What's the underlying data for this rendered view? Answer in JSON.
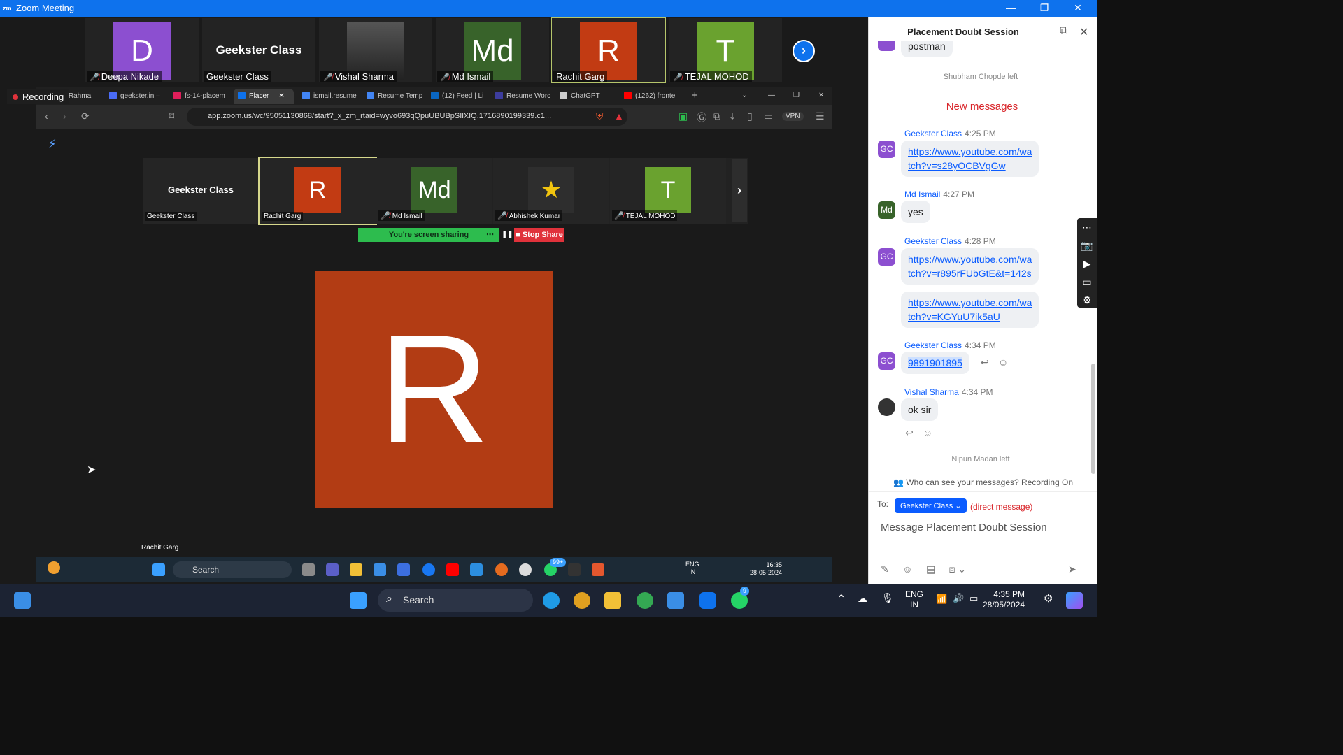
{
  "window": {
    "title": "Zoom Meeting",
    "app_icon": "zm"
  },
  "gallery": [
    {
      "initial": "D",
      "name": "Deepa Nikade",
      "color": "#8c4fd0",
      "muted": true
    },
    {
      "initial": "",
      "name": "Geekster Class",
      "label": "Geekster Class",
      "muted": false
    },
    {
      "initial": "",
      "name": "Vishal Sharma",
      "color": "#4a4a4a",
      "muted": true
    },
    {
      "initial": "Md",
      "name": "Md Ismail",
      "color": "#38632a",
      "muted": true
    },
    {
      "initial": "R",
      "name": "Rachit Garg",
      "color": "#c23b13",
      "muted": false,
      "active": true
    },
    {
      "initial": "T",
      "name": "TEJAL MOHOD",
      "color": "#6aa22f",
      "muted": true
    }
  ],
  "recording_label": "Recording",
  "browser": {
    "tabs": [
      {
        "label": "ah Rahma",
        "color": "#c0392b"
      },
      {
        "label": "geekster.in –",
        "color": "#4a6cf7"
      },
      {
        "label": "fs-14-placem",
        "color": "#e01e5a"
      },
      {
        "label": "Placer",
        "color": "#0e72ed",
        "active": true
      },
      {
        "label": "ismail.resume",
        "color": "#4285f4"
      },
      {
        "label": "Resume Temp",
        "color": "#4285f4"
      },
      {
        "label": "(12) Feed | Li",
        "color": "#0a66c2"
      },
      {
        "label": "Resume Worc",
        "color": "#3d3d9e"
      },
      {
        "label": "ChatGPT",
        "color": "#cccccc"
      },
      {
        "label": "(1262) fronte",
        "color": "#ff0000"
      }
    ],
    "url": "app.zoom.us/wc/95051130868/start?_x_zm_rtaid=wyvo693qQpuUBUBpSIlXIQ.1716890199339.c1...",
    "vpn_label": "VPN",
    "inner_gallery": [
      {
        "initial": "",
        "name": "Geekster Class",
        "label": "Geekster Class",
        "muted": false
      },
      {
        "initial": "R",
        "name": "Rachit Garg",
        "color": "#c23b13",
        "muted": false,
        "active": true
      },
      {
        "initial": "Md",
        "name": "Md Ismail",
        "color": "#38632a",
        "muted": true
      },
      {
        "initial": "★",
        "name": "Abhishek Kumar",
        "color": "#2e2e2e",
        "muted": true
      },
      {
        "initial": "T",
        "name": "TEJAL MOHOD",
        "color": "#6aa22f",
        "muted": true
      }
    ],
    "share_status": "You're screen sharing",
    "stop_share": "Stop Share",
    "main_avatar_initial": "R",
    "speaker_name": "Rachit Garg",
    "mini_taskbar": {
      "search": "Search",
      "time": "16:35",
      "date": "28-05-2024",
      "lang1": "ENG",
      "lang2": "IN",
      "wa_badge": "99+"
    }
  },
  "chat": {
    "title": "Placement Doubt Session",
    "partial_message": "postman",
    "system_left_1": "Shubham Chopde left",
    "new_messages_label": "New messages",
    "messages": [
      {
        "sender": "Geekster Class",
        "time": "4:25 PM",
        "avatar": "GC",
        "text_lines": [
          "https://www.youtube.com/wa",
          "tch?v=s28yOCBVgGw"
        ],
        "is_link": true
      },
      {
        "sender": "Md Ismail",
        "time": "4:27 PM",
        "avatar": "Md",
        "text_lines": [
          "yes"
        ]
      },
      {
        "sender": "Geekster Class",
        "time": "4:28 PM",
        "avatar": "GC",
        "text_lines": [
          "https://www.youtube.com/wa",
          "tch?v=r895rFUbGtE&t=142s"
        ],
        "is_link": true
      },
      {
        "sender": "",
        "time": "",
        "avatar": "",
        "text_lines": [
          "https://www.youtube.com/wa",
          "tch?v=KGYuU7ik5aU"
        ],
        "is_link": true
      },
      {
        "sender": "Geekster Class",
        "time": "4:34 PM",
        "avatar": "GC",
        "text_lines": [
          "9891901895"
        ],
        "is_link": true
      },
      {
        "sender": "Vishal Sharma",
        "time": "4:34 PM",
        "avatar": "",
        "text_lines": [
          "ok sir"
        ]
      }
    ],
    "system_left_2": "Nipun Madan left",
    "visibility_notice": "Who can see your messages? Recording On",
    "to_label": "To:",
    "recipient": "Geekster Class",
    "direct_label": "(direct message)",
    "compose_placeholder": "Message Placement Doubt Session"
  },
  "taskbar": {
    "search": "Search",
    "lang1": "ENG",
    "lang2": "IN",
    "time": "4:35 PM",
    "date": "28/05/2024",
    "wa_badge": "9"
  },
  "colors": {
    "zoom_blue": "#0e72ed",
    "link_blue": "#0b5cff",
    "red": "#e0323b",
    "green": "#2dbc4e"
  }
}
